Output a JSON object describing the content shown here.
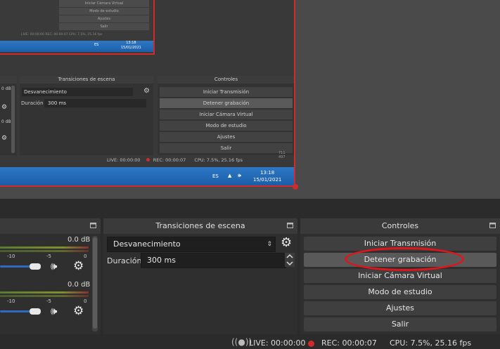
{
  "preview": {
    "level2": {
      "buttons": [
        "Iniciar Cámara Virtual",
        "Modo de estudio",
        "Ajustes",
        "Salir"
      ],
      "status": "LIVE: 00:00:00   REC: 00:00:07   CPU: 7.5%, 25.16 fps",
      "tray_lang": "ES",
      "clock_time": "13:18",
      "clock_date": "15/01/2021"
    },
    "level1": {
      "audio_db_1": "0 dB",
      "audio_db_2": "0 dB",
      "transitions_title": "Transiciones de escena",
      "transition_value": "Desvanecimiento",
      "duration_label": "Duración",
      "duration_value": "300 ms",
      "controls_title": "Controles",
      "buttons": [
        "Iniciar Transmisión",
        "Detener grabación",
        "Iniciar Cámara Virtual",
        "Modo de estudio",
        "Ajustes",
        "Salir"
      ],
      "status_live": "LIVE: 00:00:00",
      "status_rec": "REC: 00:00:07",
      "status_cpu": "CPU: 7.5%, 25.16 fps",
      "res_w": "711",
      "res_h": "497",
      "tray_lang": "ES",
      "clock_time": "13:18",
      "clock_date": "15/01/2021"
    }
  },
  "audio": {
    "channels": [
      {
        "db": "0.0 dB",
        "ticks": [
          "-10",
          "-5",
          "0"
        ],
        "volume_level": 0.72
      },
      {
        "db": "0.0 dB",
        "ticks": [
          "-10",
          "-5",
          "0"
        ],
        "volume_level": 0.72
      }
    ]
  },
  "transitions": {
    "title": "Transiciones de escena",
    "selected": "Desvanecimiento",
    "duration_label": "Duración",
    "duration_value": "300 ms"
  },
  "controls": {
    "title": "Controles",
    "buttons": [
      "Iniciar Transmisión",
      "Detener grabación",
      "Iniciar Cámara Virtual",
      "Modo de estudio",
      "Ajustes",
      "Salir"
    ],
    "active_index": 1
  },
  "status": {
    "live": "LIVE: 00:00:00",
    "rec": "REC: 00:00:07",
    "cpu": "CPU: 7.5%, 25.16 fps"
  },
  "colors": {
    "recording_red": "#d22a2a",
    "highlight_red": "#e2141b",
    "taskbar_blue": "#2d78c6",
    "slider_blue": "#2e6bc0"
  }
}
